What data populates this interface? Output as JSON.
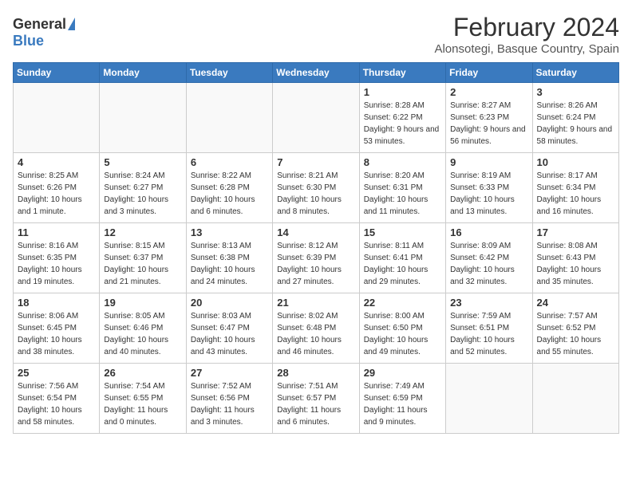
{
  "logo": {
    "general": "General",
    "blue": "Blue"
  },
  "title": "February 2024",
  "location": "Alonsotegi, Basque Country, Spain",
  "days_of_week": [
    "Sunday",
    "Monday",
    "Tuesday",
    "Wednesday",
    "Thursday",
    "Friday",
    "Saturday"
  ],
  "weeks": [
    [
      {
        "day": "",
        "info": ""
      },
      {
        "day": "",
        "info": ""
      },
      {
        "day": "",
        "info": ""
      },
      {
        "day": "",
        "info": ""
      },
      {
        "day": "1",
        "info": "Sunrise: 8:28 AM\nSunset: 6:22 PM\nDaylight: 9 hours and 53 minutes."
      },
      {
        "day": "2",
        "info": "Sunrise: 8:27 AM\nSunset: 6:23 PM\nDaylight: 9 hours and 56 minutes."
      },
      {
        "day": "3",
        "info": "Sunrise: 8:26 AM\nSunset: 6:24 PM\nDaylight: 9 hours and 58 minutes."
      }
    ],
    [
      {
        "day": "4",
        "info": "Sunrise: 8:25 AM\nSunset: 6:26 PM\nDaylight: 10 hours and 1 minute."
      },
      {
        "day": "5",
        "info": "Sunrise: 8:24 AM\nSunset: 6:27 PM\nDaylight: 10 hours and 3 minutes."
      },
      {
        "day": "6",
        "info": "Sunrise: 8:22 AM\nSunset: 6:28 PM\nDaylight: 10 hours and 6 minutes."
      },
      {
        "day": "7",
        "info": "Sunrise: 8:21 AM\nSunset: 6:30 PM\nDaylight: 10 hours and 8 minutes."
      },
      {
        "day": "8",
        "info": "Sunrise: 8:20 AM\nSunset: 6:31 PM\nDaylight: 10 hours and 11 minutes."
      },
      {
        "day": "9",
        "info": "Sunrise: 8:19 AM\nSunset: 6:33 PM\nDaylight: 10 hours and 13 minutes."
      },
      {
        "day": "10",
        "info": "Sunrise: 8:17 AM\nSunset: 6:34 PM\nDaylight: 10 hours and 16 minutes."
      }
    ],
    [
      {
        "day": "11",
        "info": "Sunrise: 8:16 AM\nSunset: 6:35 PM\nDaylight: 10 hours and 19 minutes."
      },
      {
        "day": "12",
        "info": "Sunrise: 8:15 AM\nSunset: 6:37 PM\nDaylight: 10 hours and 21 minutes."
      },
      {
        "day": "13",
        "info": "Sunrise: 8:13 AM\nSunset: 6:38 PM\nDaylight: 10 hours and 24 minutes."
      },
      {
        "day": "14",
        "info": "Sunrise: 8:12 AM\nSunset: 6:39 PM\nDaylight: 10 hours and 27 minutes."
      },
      {
        "day": "15",
        "info": "Sunrise: 8:11 AM\nSunset: 6:41 PM\nDaylight: 10 hours and 29 minutes."
      },
      {
        "day": "16",
        "info": "Sunrise: 8:09 AM\nSunset: 6:42 PM\nDaylight: 10 hours and 32 minutes."
      },
      {
        "day": "17",
        "info": "Sunrise: 8:08 AM\nSunset: 6:43 PM\nDaylight: 10 hours and 35 minutes."
      }
    ],
    [
      {
        "day": "18",
        "info": "Sunrise: 8:06 AM\nSunset: 6:45 PM\nDaylight: 10 hours and 38 minutes."
      },
      {
        "day": "19",
        "info": "Sunrise: 8:05 AM\nSunset: 6:46 PM\nDaylight: 10 hours and 40 minutes."
      },
      {
        "day": "20",
        "info": "Sunrise: 8:03 AM\nSunset: 6:47 PM\nDaylight: 10 hours and 43 minutes."
      },
      {
        "day": "21",
        "info": "Sunrise: 8:02 AM\nSunset: 6:48 PM\nDaylight: 10 hours and 46 minutes."
      },
      {
        "day": "22",
        "info": "Sunrise: 8:00 AM\nSunset: 6:50 PM\nDaylight: 10 hours and 49 minutes."
      },
      {
        "day": "23",
        "info": "Sunrise: 7:59 AM\nSunset: 6:51 PM\nDaylight: 10 hours and 52 minutes."
      },
      {
        "day": "24",
        "info": "Sunrise: 7:57 AM\nSunset: 6:52 PM\nDaylight: 10 hours and 55 minutes."
      }
    ],
    [
      {
        "day": "25",
        "info": "Sunrise: 7:56 AM\nSunset: 6:54 PM\nDaylight: 10 hours and 58 minutes."
      },
      {
        "day": "26",
        "info": "Sunrise: 7:54 AM\nSunset: 6:55 PM\nDaylight: 11 hours and 0 minutes."
      },
      {
        "day": "27",
        "info": "Sunrise: 7:52 AM\nSunset: 6:56 PM\nDaylight: 11 hours and 3 minutes."
      },
      {
        "day": "28",
        "info": "Sunrise: 7:51 AM\nSunset: 6:57 PM\nDaylight: 11 hours and 6 minutes."
      },
      {
        "day": "29",
        "info": "Sunrise: 7:49 AM\nSunset: 6:59 PM\nDaylight: 11 hours and 9 minutes."
      },
      {
        "day": "",
        "info": ""
      },
      {
        "day": "",
        "info": ""
      }
    ]
  ]
}
